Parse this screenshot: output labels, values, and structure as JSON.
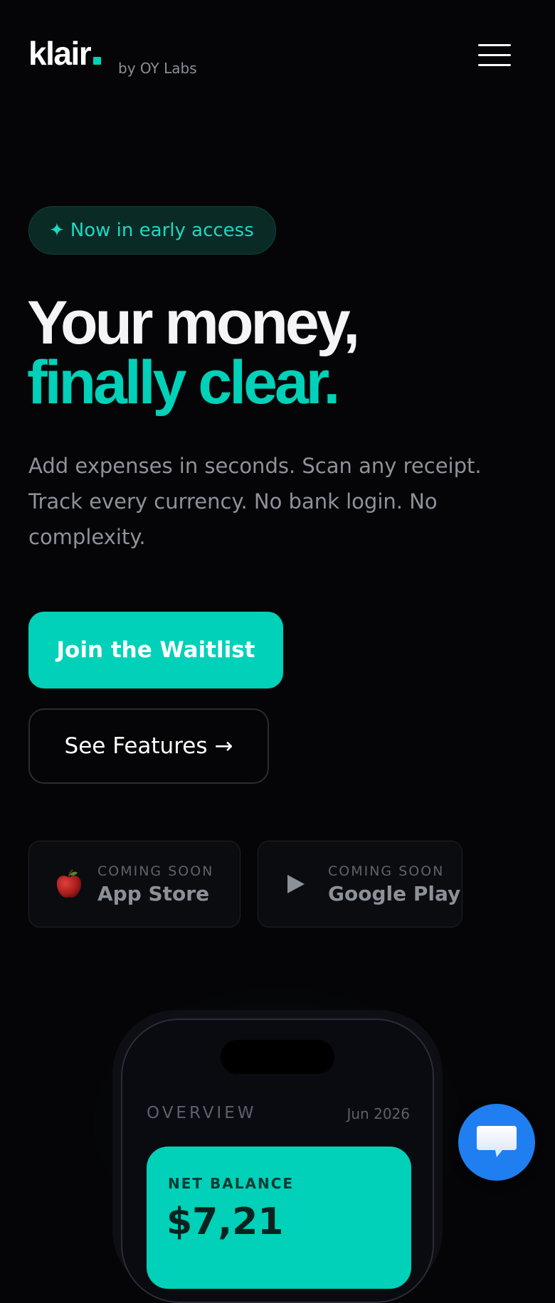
{
  "header": {
    "logo": "klair",
    "byline": "by OY Labs",
    "menu_icon": "hamburger-menu-icon"
  },
  "hero": {
    "badge_icon": "sparkle-icon",
    "badge": "Now in early access",
    "headline_line1": "Your money,",
    "headline_line2": "finally clear.",
    "lede": "Add expenses in seconds. Scan any receipt. Track every currency. No bank login. No complexity.",
    "primary_cta": "Join the Waitlist",
    "secondary_cta": "See Features",
    "secondary_cta_arrow": "→"
  },
  "stores": [
    {
      "icon": "apple-icon",
      "small": "COMING SOON",
      "name": "App Store"
    },
    {
      "icon": "play-icon",
      "small": "COMING SOON",
      "name": "Google Play"
    }
  ],
  "phone": {
    "overview_label": "OVERVIEW",
    "date": "Jun 2026",
    "balance_label": "NET BALANCE",
    "balance_value": "$7,21"
  },
  "chat": {
    "icon": "chat-bubble-icon"
  },
  "colors": {
    "background": "#050507",
    "accent": "#00d1b8",
    "muted_text": "#8e929a",
    "chat_blue": "#1f7ff0"
  }
}
